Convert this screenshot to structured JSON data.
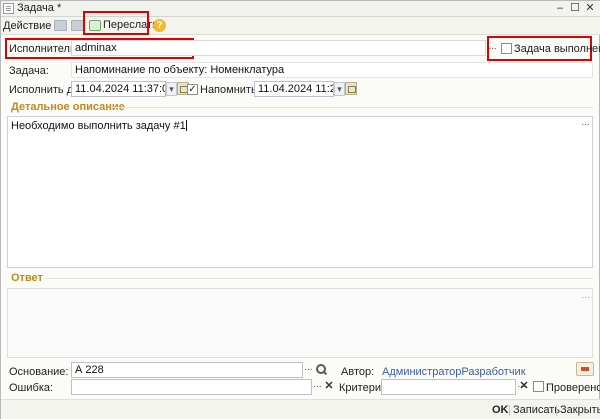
{
  "window": {
    "title": "Задача *",
    "minimize_glyph": "–",
    "maximize_glyph": "☐",
    "close_glyph": "✕"
  },
  "toolbar": {
    "action_label": "Действие ▾",
    "forward_label": "Переслать",
    "help_glyph": "?"
  },
  "fields": {
    "executor_label": "Исполнитель:",
    "executor_value": "adminax",
    "completed_label": "Задача выполнена",
    "completed_checked": false,
    "task_label": "Задача:",
    "task_value": "Напоминание по объекту: Номенклатура",
    "due_label": "Исполнить до:",
    "due_value": "11.04.2024 11:37:02",
    "remind_label": "Напомнить:",
    "remind_checked": true,
    "remind_value": "11.04.2024 11:23:02"
  },
  "description": {
    "title": "Детальное описание",
    "text": "Необходимо выполнить задачу #1"
  },
  "answer": {
    "title": "Ответ",
    "text": ""
  },
  "bottom": {
    "basis_label": "Основание:",
    "basis_value": "А 228",
    "author_label": "Автор:",
    "author_value": "АдминистраторРазработчик",
    "error_label": "Ошибка:",
    "error_value": "",
    "criterion_label": "Критерий:",
    "criterion_value": "",
    "checked_label": "Проверено",
    "checked_checked": false
  },
  "footer": {
    "ok_label": "OK",
    "save_label": "Записать",
    "close_label": "Закрыть"
  },
  "colors": {
    "highlight_box": "#e00000",
    "section_title": "#c08a20",
    "author_link": "#3b5ea8"
  },
  "icons": {
    "ellipsis": "...",
    "dropdown": "▾",
    "clear": "✕",
    "check": "✓"
  }
}
